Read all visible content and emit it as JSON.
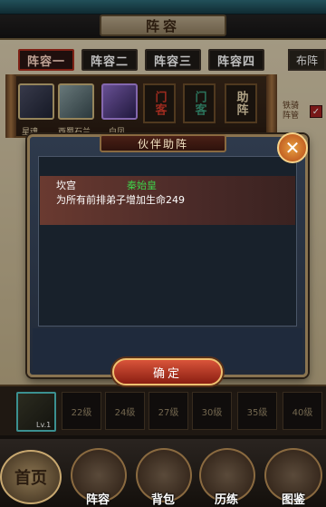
{
  "header": {
    "title": "阵容"
  },
  "formation_tabs": [
    {
      "label": "阵容一",
      "active": true
    },
    {
      "label": "阵容二",
      "active": false
    },
    {
      "label": "阵容三",
      "active": false
    },
    {
      "label": "阵容四",
      "active": false
    }
  ],
  "formation_tab_right": "布阵",
  "heroes": [
    {
      "name": "星魂"
    },
    {
      "name": "西蜀石兰"
    },
    {
      "name": "白凤"
    }
  ],
  "side_buttons": {
    "menke": "门客",
    "menke2": "门客",
    "zhuzhen": "助阵"
  },
  "side_option": {
    "label": "铁骑阵管",
    "checked": true
  },
  "dialog": {
    "title": "伙伴助阵",
    "effect": {
      "position": "坎宫",
      "hero": "秦始皇",
      "description": "为所有前排弟子增加生命249"
    },
    "confirm_label": "确定",
    "close_label": "✕"
  },
  "level_strip": {
    "hero_level": "Lv.1",
    "slots": [
      "22级",
      "24级",
      "27级",
      "30级",
      "35级",
      "40级"
    ]
  },
  "bottom_nav": {
    "home": "首页",
    "items": [
      "阵容",
      "背包",
      "历练",
      "图鉴"
    ]
  },
  "colors": {
    "accent_red": "#a92c1c",
    "hero_green": "#3fd04a",
    "button_gold": "#f0c070"
  }
}
